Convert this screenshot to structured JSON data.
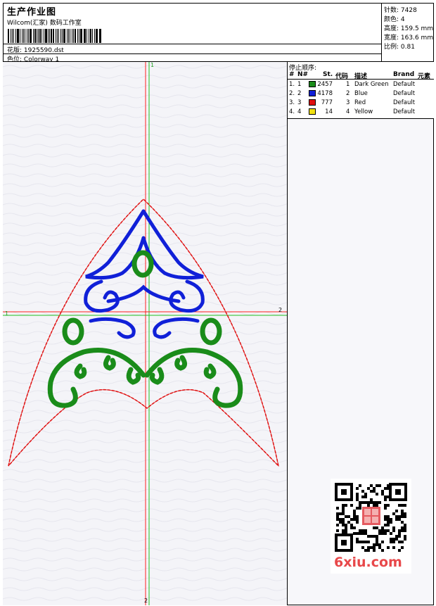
{
  "header": {
    "title": "生产作业图",
    "subtitle": "Wilcom(汇家) 数码工作室",
    "file_label": "花版:",
    "file_value": "1925590.dst",
    "colorway_label": "色位:",
    "colorway_value": "Colorway 1"
  },
  "stats": [
    {
      "label": "针数",
      "value": "7428"
    },
    {
      "label": "颜色",
      "value": "4"
    },
    {
      "label": "高度",
      "value": "159.5 mm"
    },
    {
      "label": "宽度",
      "value": "163.6 mm"
    },
    {
      "label": "比例",
      "value": "0.81"
    }
  ],
  "stop_table": {
    "title": "停止顺序:",
    "columns": [
      "#",
      "N#",
      "St.",
      "代码",
      "描述",
      "Brand",
      "元素"
    ],
    "rows": [
      {
        "idx": "1.",
        "n": "1",
        "color": "#1a8c1a",
        "st": "2457",
        "code": "1",
        "desc": "Dark Green",
        "brand": "Default"
      },
      {
        "idx": "2.",
        "n": "2",
        "color": "#1020d8",
        "st": "4178",
        "code": "2",
        "desc": "Blue",
        "brand": "Default"
      },
      {
        "idx": "3.",
        "n": "3",
        "color": "#e01010",
        "st": "777",
        "code": "3",
        "desc": "Red",
        "brand": "Default"
      },
      {
        "idx": "4.",
        "n": "4",
        "color": "#f0e010",
        "st": "14",
        "code": "4",
        "desc": "Yellow",
        "brand": "Default"
      }
    ]
  },
  "guides": {
    "vertical_top": "1",
    "vertical_bottom": "2",
    "horizontal_left": "1",
    "horizontal_right": "2"
  },
  "watermark": "6xiu.com",
  "colors": {
    "green": "#1a8c1a",
    "blue": "#1020d8",
    "red": "#e01010",
    "guide_red": "#ff2020",
    "guide_green": "#20c020"
  }
}
